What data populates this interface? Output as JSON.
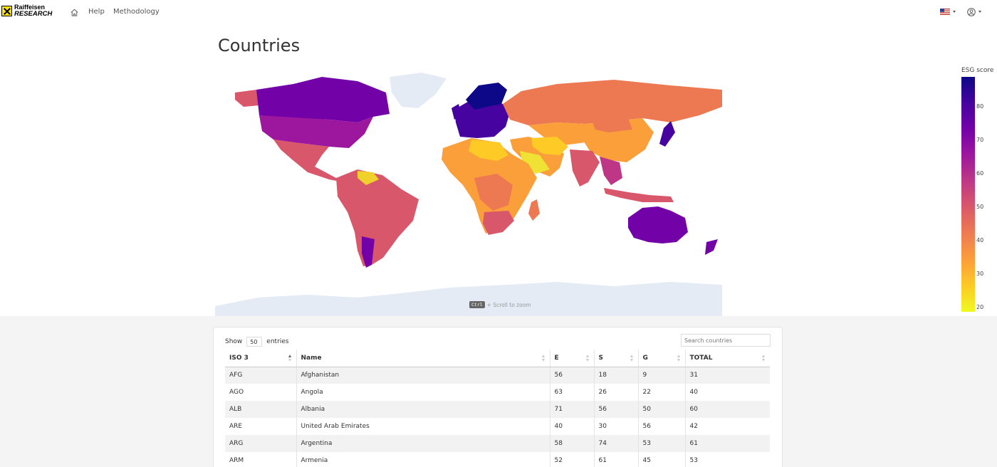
{
  "nav": {
    "logo_line1": "Raiffeisen",
    "logo_line2": "RESEARCH",
    "help": "Help",
    "methodology": "Methodology"
  },
  "page": {
    "title": "Countries"
  },
  "map": {
    "colorbar_title": "ESG score",
    "ticks": [
      "80",
      "70",
      "60",
      "50",
      "40",
      "30",
      "20"
    ],
    "zoom_key": "Ctrl",
    "zoom_hint": "+ Scroll to zoom"
  },
  "table": {
    "show_label": "Show",
    "entries_value": "50",
    "entries_label": "entries",
    "search_placeholder": "Search countries",
    "headers": [
      "ISO 3",
      "Name",
      "E",
      "S",
      "G",
      "TOTAL"
    ],
    "rows": [
      [
        "AFG",
        "Afghanistan",
        "56",
        "18",
        "9",
        "31"
      ],
      [
        "AGO",
        "Angola",
        "63",
        "26",
        "22",
        "40"
      ],
      [
        "ALB",
        "Albania",
        "71",
        "56",
        "50",
        "60"
      ],
      [
        "ARE",
        "United Arab Emirates",
        "40",
        "30",
        "56",
        "42"
      ],
      [
        "ARG",
        "Argentina",
        "58",
        "74",
        "53",
        "61"
      ],
      [
        "ARM",
        "Armenia",
        "52",
        "61",
        "45",
        "53"
      ]
    ]
  },
  "colors": {
    "logo_yellow": "#fee600",
    "scale_high": "#0d0887",
    "scale_low": "#f0f921"
  }
}
